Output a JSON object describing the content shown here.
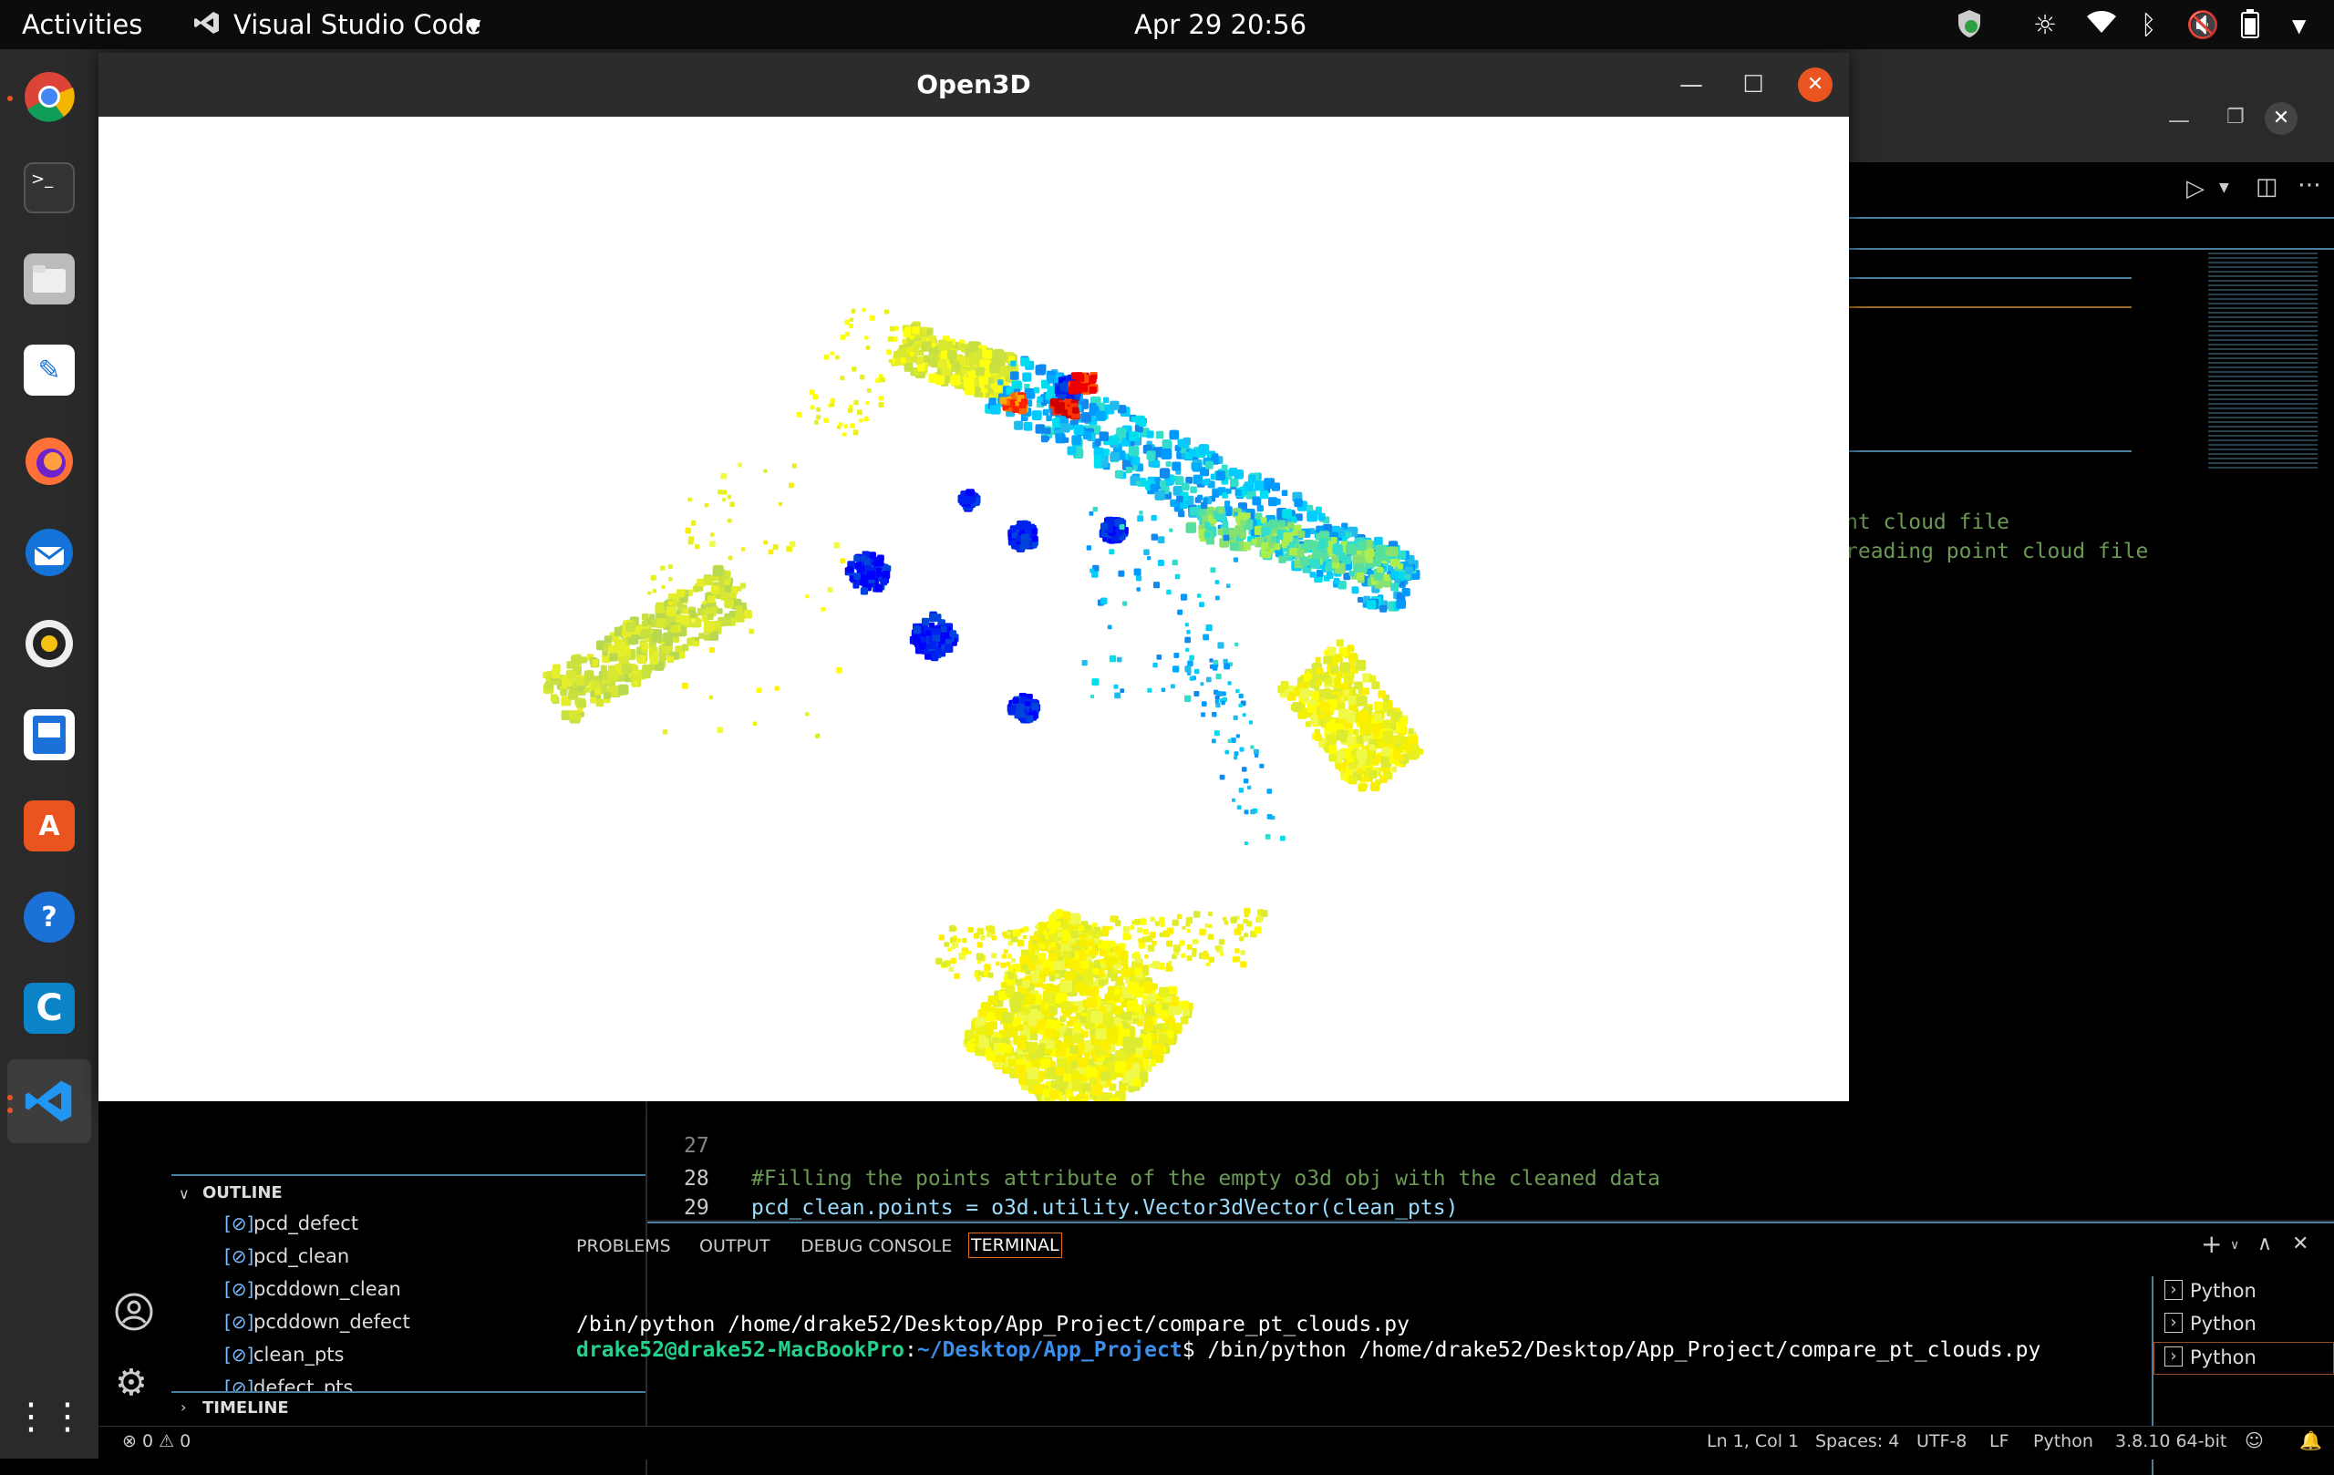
{
  "topbar": {
    "activities": "Activities",
    "app_menu": "Visual Studio Code",
    "clock": "Apr 29  20:56"
  },
  "o3d": {
    "title": "Open3D"
  },
  "editor": {
    "right_text_1": "nt cloud file",
    "right_text_2": "reading point cloud file",
    "lines": [
      {
        "num": "27",
        "text": ""
      },
      {
        "num": "28",
        "text": "#Filling the points attribute of the empty o3d obj with the cleaned data"
      },
      {
        "num": "29",
        "text": "pcd_clean.points = o3d.utility.Vector3dVector(clean_pts)"
      }
    ]
  },
  "outline": {
    "header": "OUTLINE",
    "items": [
      "pcd_defect",
      "pcd_clean",
      "pcddown_clean",
      "pcddown_defect",
      "clean_pts",
      "defect_pts"
    ],
    "timeline": "TIMELINE"
  },
  "panel": {
    "tabs": [
      "PROBLEMS",
      "OUTPUT",
      "DEBUG CONSOLE",
      "TERMINAL"
    ],
    "term_line1": "/bin/python /home/drake52/Desktop/App_Project/compare_pt_clouds.py",
    "prompt_user": "drake52@drake52-MacBookPro",
    "prompt_sep": ":",
    "prompt_path": "~/Desktop/App_Project",
    "prompt_cmd": "$ /bin/python /home/drake52/Desktop/App_Project/compare_pt_clouds.py",
    "terminals": [
      "Python",
      "Python",
      "Python"
    ]
  },
  "statusbar": {
    "problems": "⊗ 0 ⚠ 0",
    "ln_col": "Ln 1, Col 1",
    "spaces": "Spaces: 4",
    "encoding": "UTF-8",
    "eol": "LF",
    "language": "Python",
    "interpreter": "3.8.10 64-bit"
  },
  "colors": {
    "accent": "#007acc",
    "terminal_user": "#23d18b",
    "terminal_path": "#3b8eea",
    "close_button": "#e95420"
  }
}
